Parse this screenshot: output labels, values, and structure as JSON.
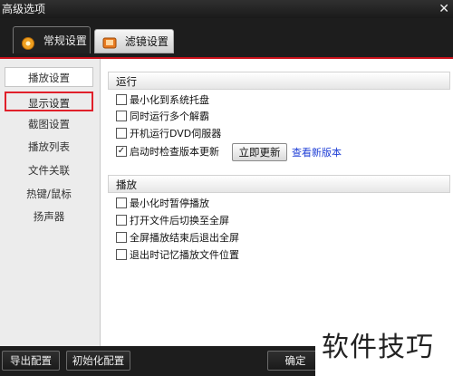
{
  "window": {
    "title": "高级选项",
    "close_glyph": "✕"
  },
  "tabs": [
    {
      "label": "常规设置",
      "icon": "gear-icon",
      "active": true
    },
    {
      "label": "滤镜设置",
      "icon": "filter-icon",
      "active": false
    }
  ],
  "sidebar": {
    "items": [
      {
        "label": "播放设置",
        "selected": true,
        "highlighted": false
      },
      {
        "label": "显示设置",
        "selected": false,
        "highlighted": true
      },
      {
        "label": "截图设置"
      },
      {
        "label": "播放列表"
      },
      {
        "label": "文件关联"
      },
      {
        "label": "热键/鼠标"
      },
      {
        "label": "扬声器"
      }
    ]
  },
  "sections": {
    "run": {
      "title": "运行",
      "options": [
        {
          "label": "最小化到系统托盘",
          "checked": false
        },
        {
          "label": "同时运行多个解霸",
          "checked": false
        },
        {
          "label": "开机运行DVD伺服器",
          "checked": false
        },
        {
          "label": "启动时检查版本更新",
          "checked": true
        }
      ],
      "update_button": "立即更新",
      "view_new_version_link": "查看新版本"
    },
    "play": {
      "title": "播放",
      "options": [
        {
          "label": "最小化时暂停播放",
          "checked": false
        },
        {
          "label": "打开文件后切换至全屏",
          "checked": false
        },
        {
          "label": "全屏播放结束后退出全屏",
          "checked": false
        },
        {
          "label": "退出时记忆播放文件位置",
          "checked": false
        }
      ]
    }
  },
  "footer": {
    "export_button": "导出配置",
    "reset_button": "初始化配置",
    "ok_button": "确定"
  },
  "watermark": "软件技巧",
  "colors": {
    "accent_red": "#c8101a",
    "highlight_red": "#e0202a",
    "link_blue": "#1f3fd6"
  }
}
